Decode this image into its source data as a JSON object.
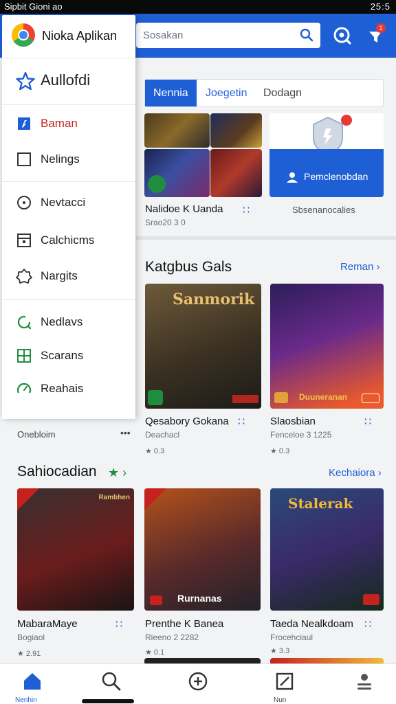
{
  "status": {
    "left": "Sipbit Gioni ao",
    "right": "25:5"
  },
  "search": {
    "placeholder": "Sosakan"
  },
  "topbar": {
    "notif_badge": "1"
  },
  "tabs": [
    "Nennia",
    "Joegetin",
    "Dodagn"
  ],
  "featured": {
    "title": "Nalidoe K Uanda",
    "sub": "Srao20 3 0",
    "promo_label": "Pemclenobdan",
    "promo_caption": "Sbsenanocalies"
  },
  "section1": {
    "title": "Katgbus Gals",
    "link": "Reman",
    "cards": [
      {
        "title": "Qesabory Gokana",
        "sub": "Deachacl",
        "rating": "0.3",
        "art": "Sanmorik"
      },
      {
        "title": "Slaosbian",
        "sub": "Fenceloe 3 1225",
        "rating": "0.3",
        "art": "Duuneranan"
      }
    ]
  },
  "overlay_item": {
    "label": "Onebloim"
  },
  "section2": {
    "title": "Sahiocadian",
    "link": "Kechaiora",
    "cards": [
      {
        "title": "MabaraMaye",
        "sub": "Bogiaol",
        "rating": "2.91",
        "art": "Rambhen"
      },
      {
        "title": "Prenthe K Banea",
        "sub": "Rieeno 2 2282",
        "rating": "0.1",
        "art": "Rurnanas"
      },
      {
        "title": "Taeda Nealkdoam",
        "sub": "Frocehciaul",
        "rating": "3.3",
        "art": "Stalerak"
      }
    ]
  },
  "drawer": {
    "header": "Nioka Aplikan",
    "favorite": "Aullofdi",
    "items": [
      {
        "label": "Baman",
        "icon": "bookmark-icon",
        "color": "#c5221f"
      },
      {
        "label": "Nelings",
        "icon": "checkbox-icon",
        "color": "#222222"
      },
      {
        "label": "Nevtacci",
        "icon": "compass-icon",
        "color": "#222222"
      },
      {
        "label": "Calchicms",
        "icon": "calendar-icon",
        "color": "#222222"
      },
      {
        "label": "Nargits",
        "icon": "badge-icon",
        "color": "#222222"
      },
      {
        "label": "Nedlavs",
        "icon": "refresh-icon",
        "color": "#222222"
      },
      {
        "label": "Scarans",
        "icon": "grid-icon",
        "color": "#222222"
      },
      {
        "label": "Reahais",
        "icon": "speed-icon",
        "color": "#222222"
      }
    ]
  },
  "bottomnav": {
    "home_label": "Nenhin",
    "profile_label": "Nun"
  },
  "colors": {
    "accent": "#1f5fd6",
    "drawer_active": "#c5221f",
    "green": "#1e8e3e"
  }
}
